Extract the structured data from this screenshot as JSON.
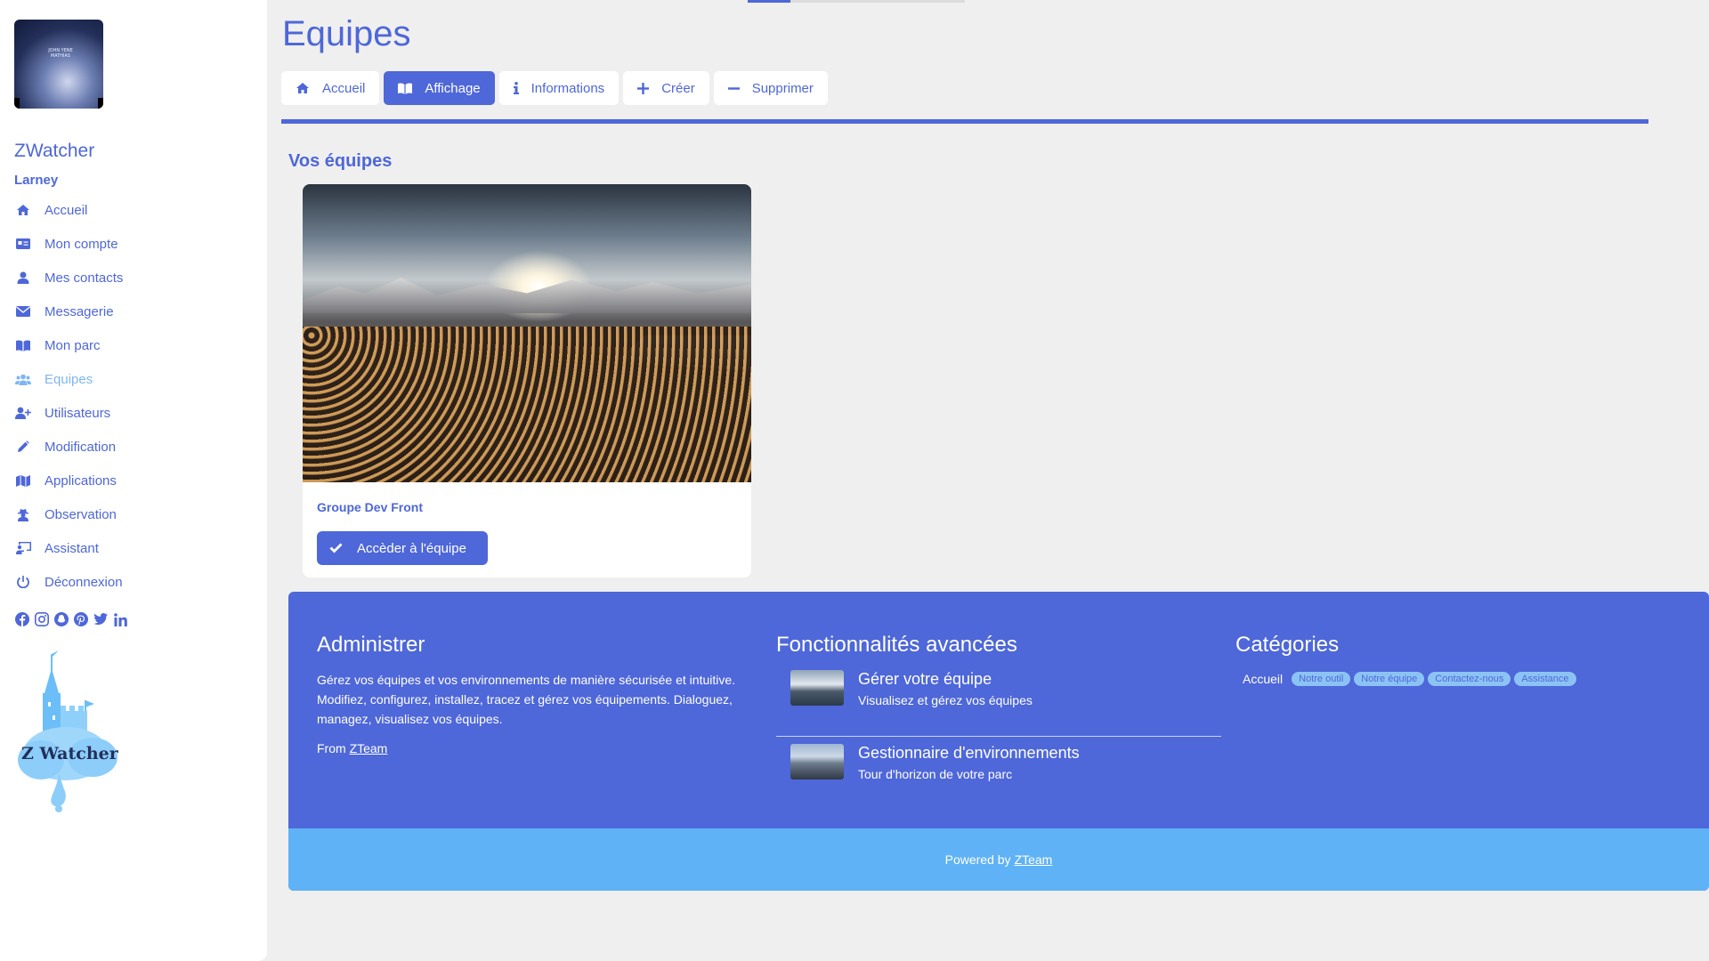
{
  "sidebar": {
    "avatar_text": "JOHN YENE MATHIAS",
    "brand": "ZWatcher",
    "username": "Larney",
    "items": [
      {
        "label": "Accueil",
        "icon": "home-icon"
      },
      {
        "label": "Mon compte",
        "icon": "id-card-icon"
      },
      {
        "label": "Mes contacts",
        "icon": "user-icon"
      },
      {
        "label": "Messagerie",
        "icon": "envelope-icon"
      },
      {
        "label": "Mon parc",
        "icon": "book-open-icon"
      },
      {
        "label": "Equipes",
        "icon": "users-icon",
        "active": true
      },
      {
        "label": "Utilisateurs",
        "icon": "user-plus-icon"
      },
      {
        "label": "Modification",
        "icon": "pencil-icon"
      },
      {
        "label": "Applications",
        "icon": "map-icon"
      },
      {
        "label": "Observation",
        "icon": "user-secret-icon"
      },
      {
        "label": "Assistant",
        "icon": "chalkboard-icon"
      },
      {
        "label": "Déconnexion",
        "icon": "power-icon"
      }
    ],
    "social": [
      "facebook-icon",
      "instagram-icon",
      "snapchat-icon",
      "pinterest-icon",
      "twitter-icon",
      "linkedin-icon"
    ],
    "logo_text": "Z Watcher"
  },
  "header": {
    "title": "Equipes"
  },
  "tabs": [
    {
      "label": "Accueil",
      "icon": "home-icon"
    },
    {
      "label": "Affichage",
      "icon": "book-open-icon",
      "active": true
    },
    {
      "label": "Informations",
      "icon": "info-icon"
    },
    {
      "label": "Créer",
      "icon": "plus-icon"
    },
    {
      "label": "Supprimer",
      "icon": "minus-icon"
    }
  ],
  "section": {
    "title": "Vos équipes"
  },
  "card": {
    "name": "Groupe Dev Front",
    "button_label": "Accèder à l'équipe"
  },
  "footer": {
    "administrer": {
      "title": "Administrer",
      "text": "Gérez vos équipes et vos environnements de manière sécurisée et intuitive. Modifiez, configurez, installez, tracez et gérez vos équipements. Dialoguez, managez, visualisez vos équipes.",
      "from_prefix": "From",
      "from_link": "ZTeam"
    },
    "features": {
      "title": "Fonctionnalités avancées",
      "items": [
        {
          "title": "Gérer votre équipe",
          "subtitle": "Visualisez et gérez vos équipes"
        },
        {
          "title": "Gestionnaire d'environnements",
          "subtitle": "Tour d'horizon de votre parc"
        }
      ]
    },
    "categories": {
      "title": "Catégories",
      "home": "Accueil",
      "badges": [
        "Notre outil",
        "Notre équipe",
        "Contactez-nous",
        "Assistance"
      ]
    },
    "powered_prefix": "Powered by",
    "powered_link": "ZTeam"
  },
  "colors": {
    "primary": "#4e67d9",
    "accent_light": "#5fb2f5",
    "active_nav": "#7fb6f2",
    "background": "#efefef"
  }
}
